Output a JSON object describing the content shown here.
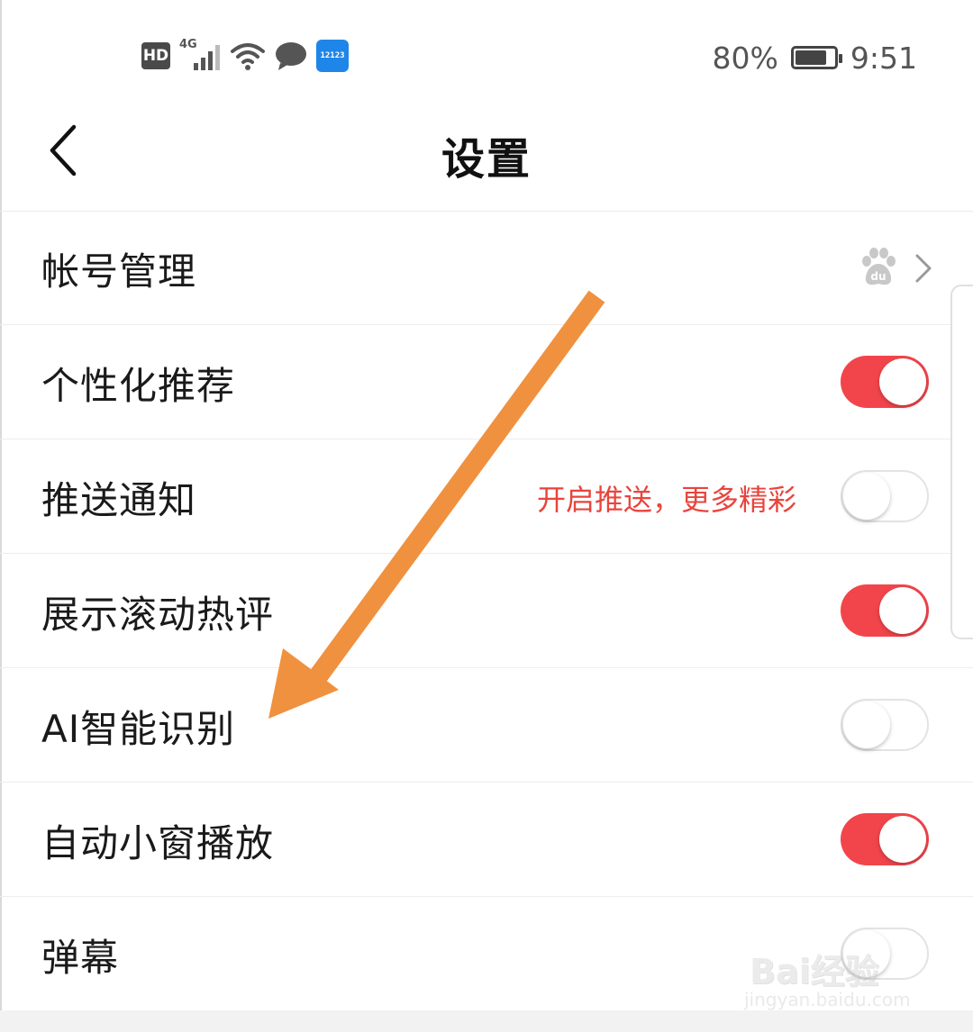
{
  "status_bar": {
    "hd": "HD",
    "signal_label": "4G",
    "app_badge": "12123",
    "battery_percent": "80%",
    "battery_level": 0.8,
    "time": "9:51"
  },
  "header": {
    "title": "设置",
    "back_icon": "chevron-left-icon"
  },
  "settings": [
    {
      "label": "帐号管理",
      "control": "link",
      "icons": [
        "baidu-paw-icon",
        "chevron-right-icon"
      ]
    },
    {
      "label": "个性化推荐",
      "control": "toggle",
      "on": true
    },
    {
      "label": "推送通知",
      "control": "toggle",
      "on": false,
      "hint": "开启推送，更多精彩"
    },
    {
      "label": "展示滚动热评",
      "control": "toggle",
      "on": true
    },
    {
      "label": "AI智能识别",
      "control": "toggle",
      "on": false
    },
    {
      "label": "自动小窗播放",
      "control": "toggle",
      "on": true
    },
    {
      "label": "弹幕",
      "control": "toggle",
      "on": false
    }
  ],
  "colors": {
    "toggle_on": "#f2454b",
    "hint_text": "#e8453c",
    "annotation_arrow": "#f0913f"
  },
  "watermark": {
    "logo": "Bai经验",
    "url": "jingyan.baidu.com"
  }
}
